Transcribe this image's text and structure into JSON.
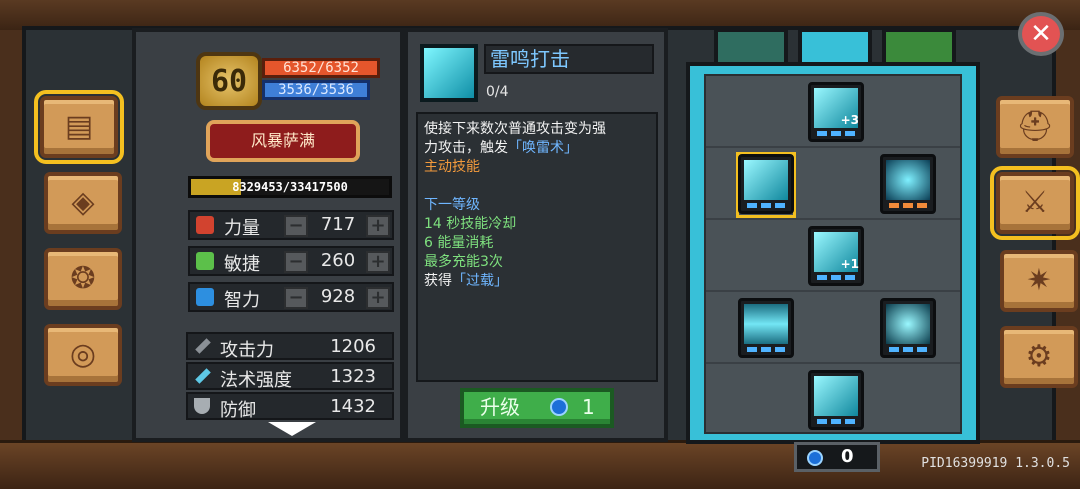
{
  "header": {
    "level": "60",
    "hp": "6352/6352",
    "mp": "3536/3536",
    "class_name": "风暴萨满",
    "xp": "8329453/33417500",
    "xp_fraction": 0.25
  },
  "stats": [
    {
      "label": "力量",
      "value": "717",
      "icon": "fist-icon",
      "color": "#d2432f"
    },
    {
      "label": "敏捷",
      "value": "260",
      "icon": "feather-icon",
      "color": "#5cc04a"
    },
    {
      "label": "智力",
      "value": "928",
      "icon": "book-icon",
      "color": "#2d8fe0"
    }
  ],
  "attributes": [
    {
      "label": "攻击力",
      "value": "1206",
      "icon": "sword-icon"
    },
    {
      "label": "法术强度",
      "value": "1323",
      "icon": "wand-icon"
    },
    {
      "label": "防御",
      "value": "1432",
      "icon": "shield-icon"
    }
  ],
  "skill": {
    "title": "雷鸣打击",
    "progress": "0/4",
    "desc_line1": "使接下来数次普通攻击变为强",
    "desc_line2a": "力攻击，触发",
    "desc_line2b": "「唤雷术」",
    "type": "主动技能",
    "next_level_header": "下一等级",
    "next_1": "14 秒技能冷却",
    "next_2": "6 能量消耗",
    "next_3": "最多充能3次",
    "next_4a": "获得",
    "next_4b": "「过载」"
  },
  "upgrade": {
    "label": "升级",
    "cost": "1"
  },
  "skill_points": "0",
  "tree_tags": {
    "node1": "+3",
    "node4": "+1"
  },
  "close_label": "✕",
  "version": "PID16399919 1.3.0.5"
}
